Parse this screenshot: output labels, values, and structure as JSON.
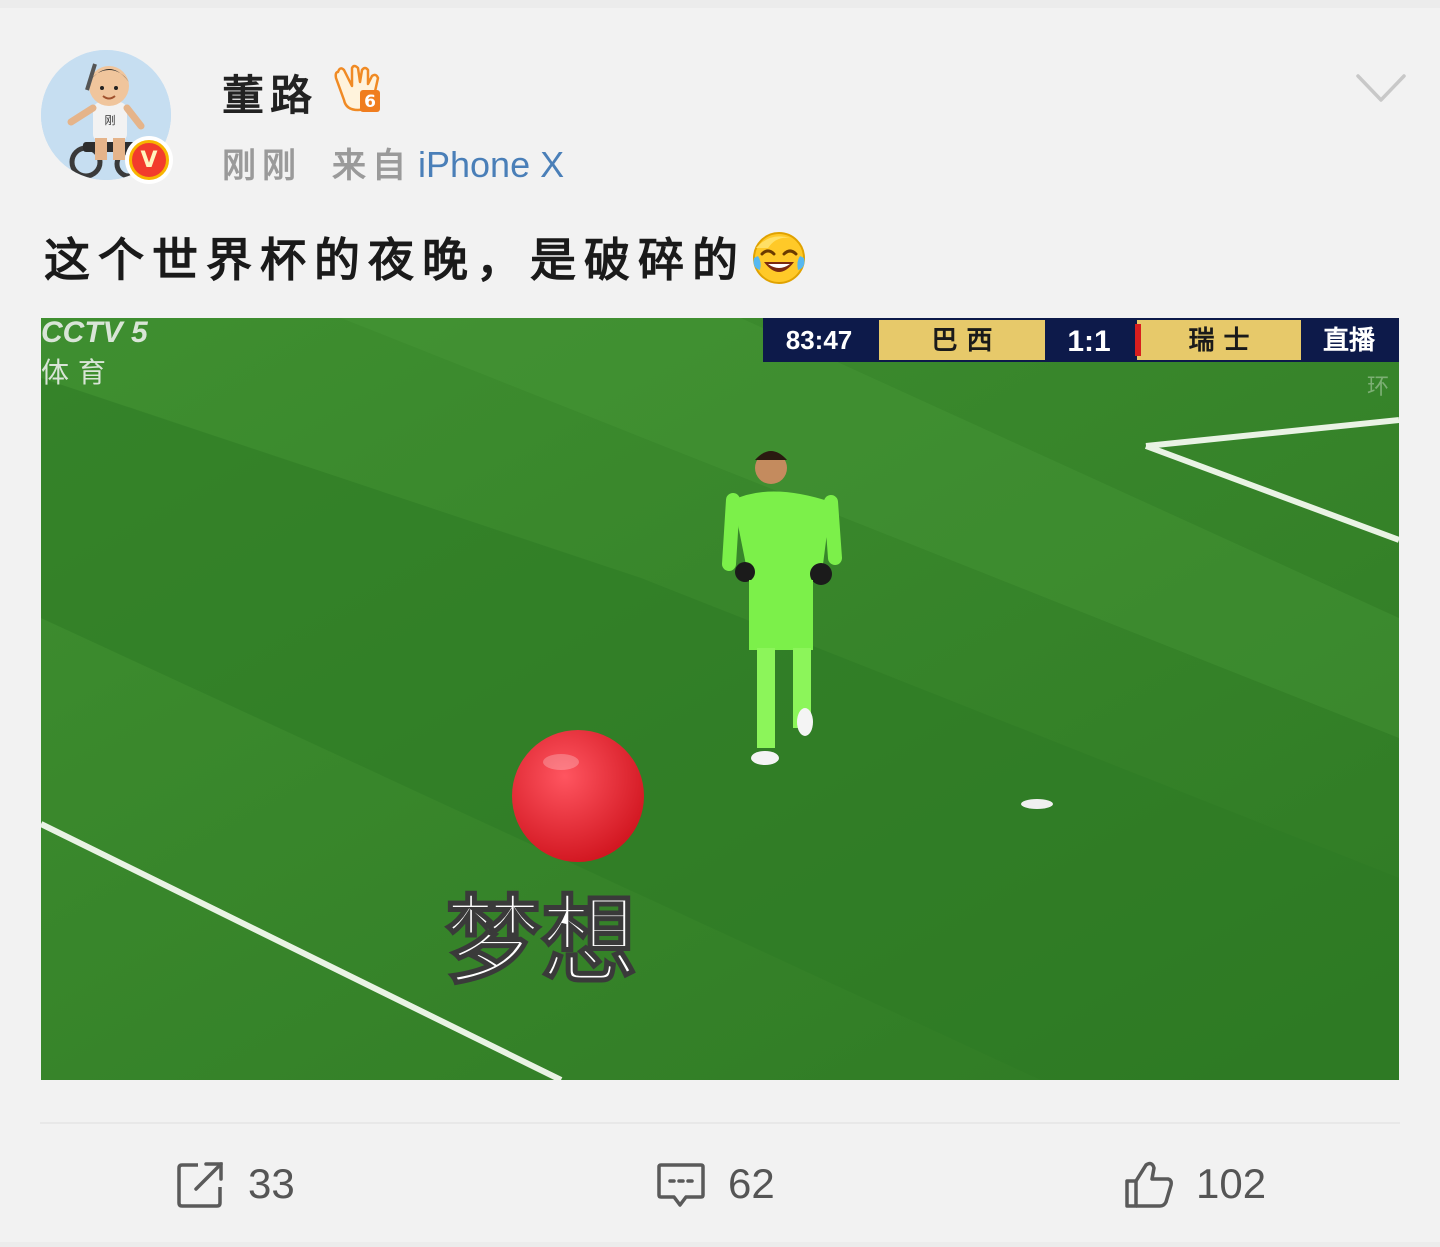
{
  "post": {
    "user": {
      "name": "董路",
      "avatar_icon": "kid-on-bike-avatar",
      "verified_badge": "V",
      "level_icon": "hand-level-6-icon",
      "level_number": "6"
    },
    "time": "刚刚",
    "source_prefix": "来自",
    "source_device": "iPhone X",
    "text": "这个世界杯的夜晚，是破碎的",
    "text_emoji": "laughing-crying-emoji"
  },
  "video": {
    "channel_logo": "CCTV 5",
    "channel_sub": "体 育",
    "scoreboard": {
      "clock": "83:47",
      "team_home": "巴 西",
      "score": "1:1",
      "team_away": "瑞 士",
      "live": "直播"
    },
    "caption": "梦想",
    "watermark": "环"
  },
  "actions": {
    "repost_count": "33",
    "comment_count": "62",
    "like_count": "102"
  },
  "colors": {
    "link_blue": "#4a7fb8",
    "pitch_green": "#3d8a2e",
    "balloon_red": "#e8202a"
  }
}
